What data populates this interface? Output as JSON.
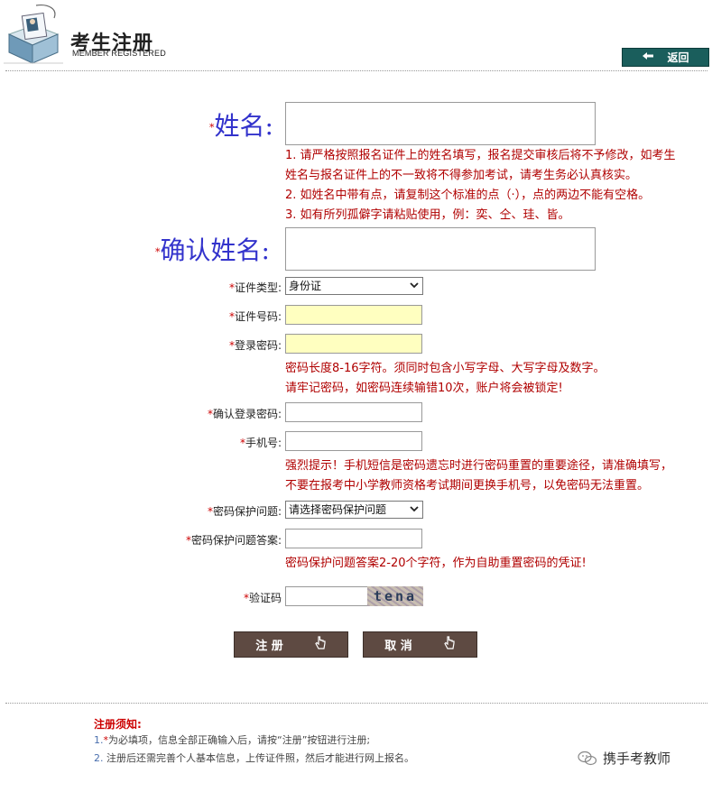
{
  "header": {
    "title": "考生注册",
    "subtitle": "MEMBER REGISTERED",
    "back_label": "返回"
  },
  "form": {
    "name": {
      "label": "姓名:",
      "star": "*"
    },
    "name_notes": [
      "1. 请严格按照报名证件上的姓名填写，报名提交审核后将不予修改，如考生",
      "姓名与报名证件上的不一致将不得参加考试，请考生务必认真核实。",
      "2. 如姓名中带有点，请复制这个标准的点（·），点的两边不能有空格。",
      "3. 如有所列孤僻字请粘贴使用，例：奕、仝、珪、皆。"
    ],
    "confirm_name": {
      "label": "确认姓名:",
      "star": "*"
    },
    "id_type": {
      "label": "证件类型:",
      "value": "身份证"
    },
    "id_number": {
      "label": "证件号码:"
    },
    "password": {
      "label": "登录密码:"
    },
    "password_notes": [
      "密码长度8-16字符。须同时包含小写字母、大写字母及数字。",
      "请牢记密码，如密码连续输错10次，账户将会被锁定!"
    ],
    "confirm_password": {
      "label": "确认登录密码:"
    },
    "phone": {
      "label": "手机号:"
    },
    "phone_notes": [
      "强烈提示！手机短信是密码遗忘时进行密码重置的重要途径，请准确填写，",
      "不要在报考中小学教师资格考试期间更换手机号，以免密码无法重置。"
    ],
    "security_question": {
      "label": "密码保护问题:",
      "value": "请选择密码保护问题"
    },
    "security_answer": {
      "label": "密码保护问题答案:"
    },
    "security_answer_note": "密码保护问题答案2-20个字符，作为自助重置密码的凭证!",
    "captcha": {
      "label": "验证码",
      "image_text": "tena"
    },
    "star": "*"
  },
  "buttons": {
    "register": "注 册",
    "cancel": "取 消"
  },
  "footer": {
    "title": "注册须知:",
    "line1_num": "1.",
    "line1_text": "为必填项，信息全部正确输入后，请按“注册”按钮进行注册;",
    "line2_num": "2.",
    "line2_text": "注册后还需完善个人基本信息，上传证件照，然后才能进行网上报名。"
  },
  "watermark": "携手考教师",
  "colors": {
    "accent_teal": "#1a5e5c",
    "button_brown": "#5e4a42",
    "note_red": "#b00000",
    "big_label_blue": "#3333cc",
    "input_yellow": "#ffffc0"
  },
  "icons": {
    "logo": "id-badge-icon",
    "back": "back-arrow-icon",
    "hand": "pointer-hand-icon",
    "select": "chevron-down-icon"
  }
}
